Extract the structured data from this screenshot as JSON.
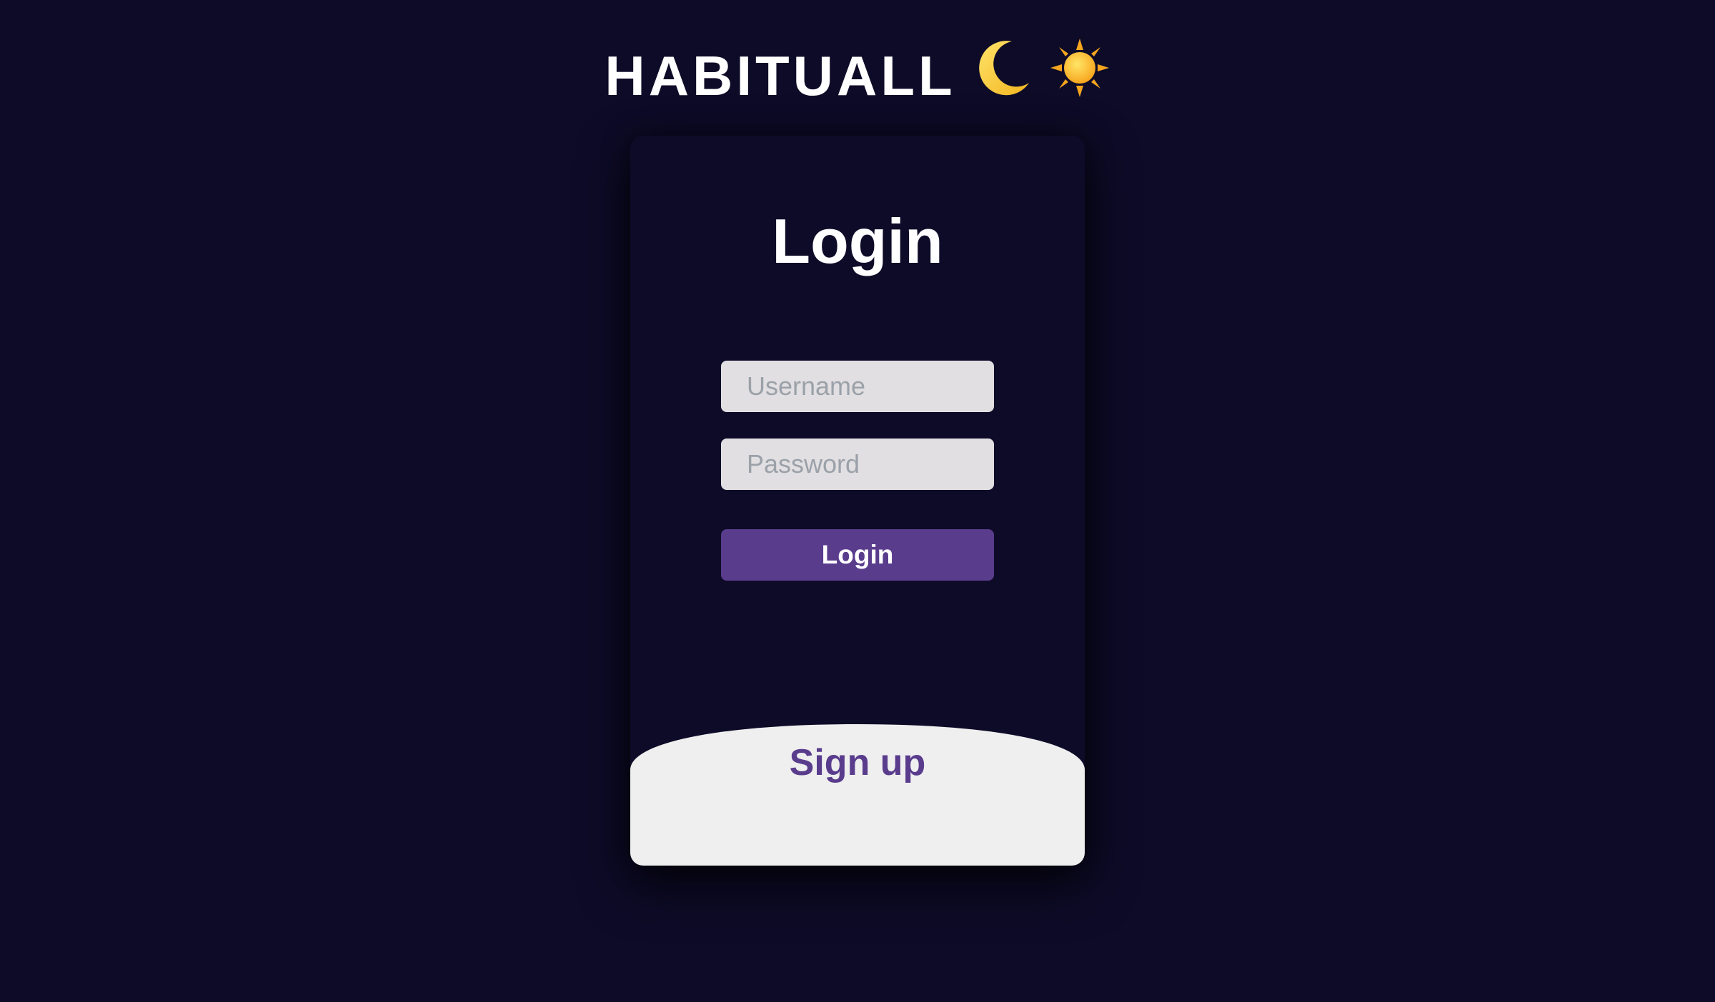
{
  "header": {
    "title": "HABITUALL",
    "moon_icon": "crescent-moon-icon",
    "sun_icon": "sun-icon"
  },
  "login_card": {
    "heading": "Login",
    "username_placeholder": "Username",
    "username_value": "",
    "password_placeholder": "Password",
    "password_value": "",
    "login_button_label": "Login",
    "signup_label": "Sign up"
  },
  "colors": {
    "background": "#0e0b28",
    "field_background": "#e1dfe1",
    "accent_purple": "#5a3c8d",
    "signup_panel": "#efefef",
    "text_white": "#ffffff"
  }
}
